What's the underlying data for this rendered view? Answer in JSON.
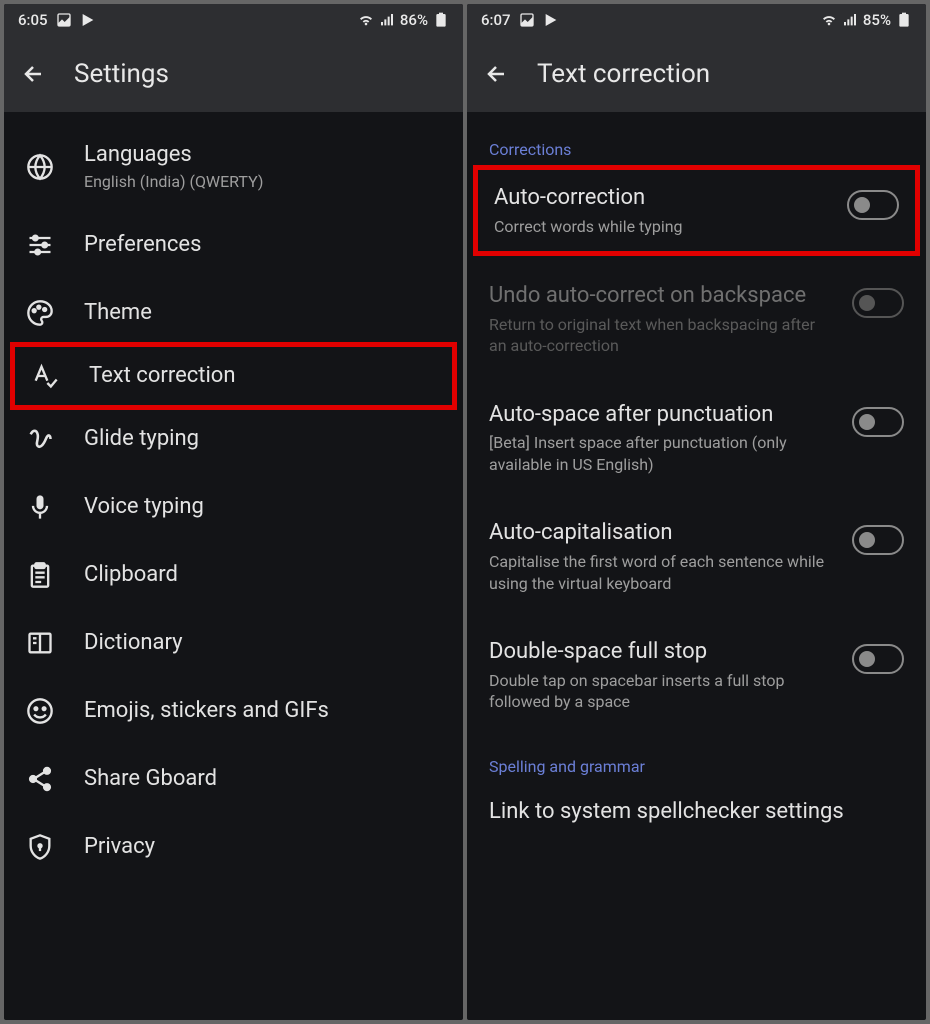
{
  "left": {
    "status": {
      "time": "6:05",
      "battery": "86%"
    },
    "header": {
      "title": "Settings"
    },
    "items": [
      {
        "title": "Languages",
        "subtitle": "English (India) (QWERTY)"
      },
      {
        "title": "Preferences"
      },
      {
        "title": "Theme"
      },
      {
        "title": "Text correction"
      },
      {
        "title": "Glide typing"
      },
      {
        "title": "Voice typing"
      },
      {
        "title": "Clipboard"
      },
      {
        "title": "Dictionary"
      },
      {
        "title": "Emojis, stickers and GIFs"
      },
      {
        "title": "Share Gboard"
      },
      {
        "title": "Privacy"
      }
    ]
  },
  "right": {
    "status": {
      "time": "6:07",
      "battery": "85%"
    },
    "header": {
      "title": "Text correction"
    },
    "section1": "Corrections",
    "toggles": [
      {
        "title": "Auto-correction",
        "subtitle": "Correct words while typing"
      },
      {
        "title": "Undo auto-correct on backspace",
        "subtitle": "Return to original text when backspacing after an auto-correction"
      },
      {
        "title": "Auto-space after punctuation",
        "subtitle": "[Beta] Insert space after punctuation (only available in US English)"
      },
      {
        "title": "Auto-capitalisation",
        "subtitle": "Capitalise the first word of each sentence while using the virtual keyboard"
      },
      {
        "title": "Double-space full stop",
        "subtitle": "Double tap on spacebar inserts a full stop followed by a space"
      }
    ],
    "section2": "Spelling and grammar",
    "spellcheck": {
      "title": "Link to system spellchecker settings"
    }
  }
}
